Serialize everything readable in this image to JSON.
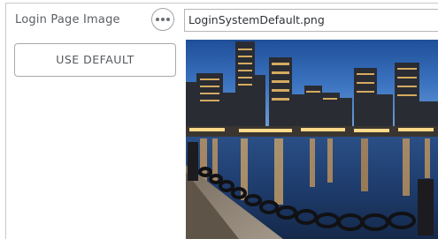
{
  "login_image": {
    "label": "Login Page Image",
    "more_icon": "ellipsis-icon",
    "filename": "LoginSystemDefault.png",
    "use_default_label": "USE DEFAULT",
    "preview_alt": "City skyline at night over the harbor"
  }
}
